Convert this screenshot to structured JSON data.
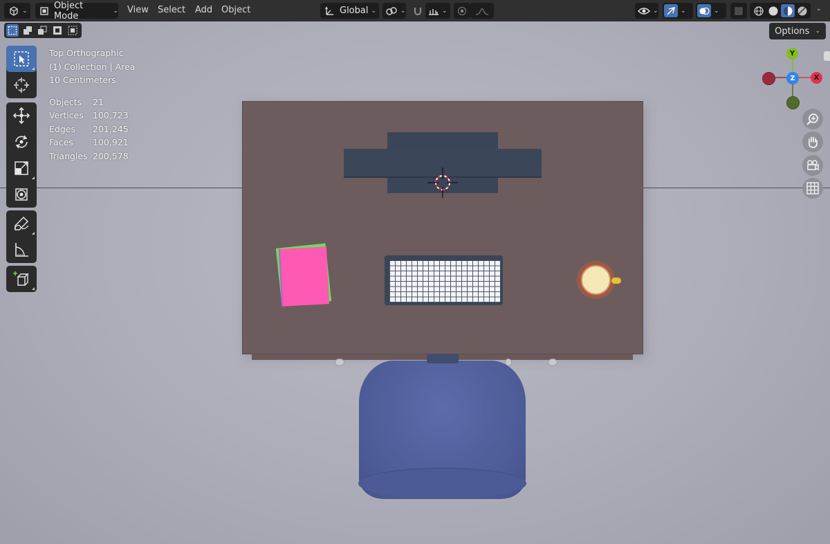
{
  "header": {
    "editor_type_icon": "view3d-icon",
    "mode": {
      "label": "Object Mode",
      "icon": "object-mode-icon"
    },
    "menus": [
      "View",
      "Select",
      "Add",
      "Object"
    ],
    "transform_orientation": {
      "label": "Global",
      "icon": "orientation-icon"
    },
    "pivot_icon": "pivot-icon",
    "snap_icon": "magnet-icon",
    "snap_target_icon": "snap-increment-icon",
    "proportional_icon": "proportional-edit-icon",
    "falloff_icon": "falloff-curve-icon",
    "right_controls": [
      "visibility-icon",
      "gizmo-icon",
      "overlay-icon",
      "xray-icon",
      "wireframe-shading-icon",
      "solid-shading-icon",
      "material-shading-icon",
      "rendered-shading-icon"
    ]
  },
  "toolrow": {
    "select_modes": [
      "select-new-icon",
      "select-extend-icon",
      "select-subtract-icon",
      "select-invert-icon",
      "select-intersect-icon"
    ],
    "options_label": "Options"
  },
  "toolbar": {
    "tools": [
      "select-box-icon",
      "cursor-icon",
      "move-icon",
      "rotate-icon",
      "scale-icon",
      "transform-icon",
      "annotate-icon",
      "measure-icon",
      "add-cube-icon"
    ],
    "active_tool": "select-box-icon"
  },
  "viewport": {
    "view_name": "Top Orthographic",
    "collection": "(1) Collection | Area",
    "scale": "10 Centimeters",
    "stats": [
      {
        "label": "Objects",
        "value": "21"
      },
      {
        "label": "Vertices",
        "value": "100,723"
      },
      {
        "label": "Edges",
        "value": "201,245"
      },
      {
        "label": "Faces",
        "value": "100,921"
      },
      {
        "label": "Triangles",
        "value": "200,578"
      }
    ]
  },
  "gizmo": {
    "axes": {
      "x": "X",
      "y": "Y",
      "z": "Z"
    },
    "colors": {
      "x": "#e0334c",
      "y": "#7fbf1f",
      "z": "#2f86e8",
      "x_neg": "#9c2a3d",
      "y_neg": "#4f6d26"
    },
    "nav_buttons": [
      "zoom-icon",
      "pan-hand-icon",
      "camera-icon",
      "grid-ortho-icon"
    ]
  },
  "colors": {
    "accent": "#4772b3",
    "header_bg": "#303030",
    "desk": "#6d5c5d",
    "chair": "#4e5c98",
    "paper_pink": "#ff5ab3",
    "paper_green": "#6be058",
    "monitor": "#3b4658"
  }
}
